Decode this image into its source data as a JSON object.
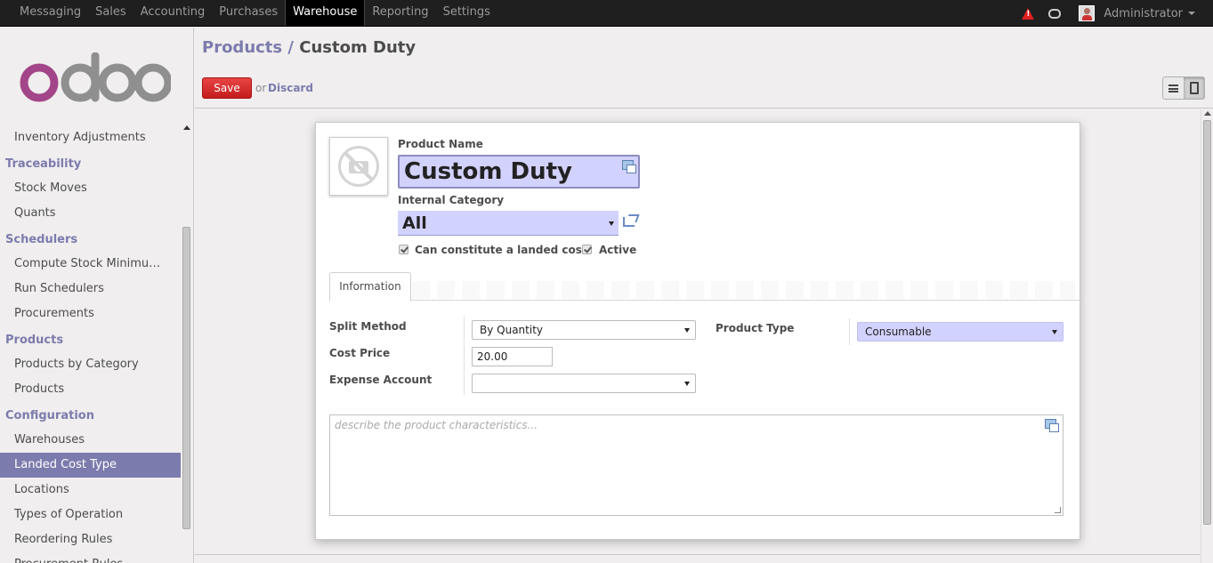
{
  "topbar": {
    "menu": [
      "Messaging",
      "Sales",
      "Accounting",
      "Purchases",
      "Warehouse",
      "Reporting",
      "Settings"
    ],
    "active": "Warehouse",
    "user": "Administrator"
  },
  "sidebar": {
    "items": [
      {
        "type": "item",
        "label": "Inventory Adjustments"
      },
      {
        "type": "section",
        "label": "Traceability"
      },
      {
        "type": "item",
        "label": "Stock Moves"
      },
      {
        "type": "item",
        "label": "Quants"
      },
      {
        "type": "section",
        "label": "Schedulers"
      },
      {
        "type": "item",
        "label": "Compute Stock Minimu…"
      },
      {
        "type": "item",
        "label": "Run Schedulers"
      },
      {
        "type": "item",
        "label": "Procurements"
      },
      {
        "type": "section",
        "label": "Products"
      },
      {
        "type": "item",
        "label": "Products by Category"
      },
      {
        "type": "item",
        "label": "Products"
      },
      {
        "type": "section",
        "label": "Configuration"
      },
      {
        "type": "item",
        "label": "Warehouses"
      },
      {
        "type": "item",
        "label": "Landed Cost Type",
        "active": true
      },
      {
        "type": "item",
        "label": "Locations"
      },
      {
        "type": "item",
        "label": "Types of Operation"
      },
      {
        "type": "item",
        "label": "Reordering Rules"
      },
      {
        "type": "item",
        "label": "Procurement Rules"
      }
    ]
  },
  "header": {
    "breadcrumb_parent": "Products",
    "breadcrumb_sep": "/",
    "breadcrumb_current": "Custom Duty",
    "save_label": "Save",
    "or_label": "or",
    "discard_label": "Discard"
  },
  "form": {
    "product_name_label": "Product Name",
    "product_name_value": "Custom Duty",
    "internal_category_label": "Internal Category",
    "internal_category_value": "All",
    "landed_cost_label": "Can constitute a landed cost",
    "active_label": "Active",
    "tab_information": "Information",
    "split_method_label": "Split Method",
    "split_method_value": "By Quantity",
    "cost_price_label": "Cost Price",
    "cost_price_value": "20.00",
    "expense_account_label": "Expense Account",
    "expense_account_value": "",
    "product_type_label": "Product Type",
    "product_type_value": "Consumable",
    "description_placeholder": "describe the product characteristics..."
  },
  "colors": {
    "accent": "#7c7bad",
    "save": "#dc3030",
    "highlight_input": "#d2d2ff",
    "logo_o": "#a24689",
    "logo_doo": "#8f8f8f"
  },
  "icons": {
    "warning": "warning-icon",
    "chat": "chat-icon",
    "avatar": "avatar",
    "translate": "translate-icon",
    "external": "external-link-icon",
    "camera": "no-image-icon"
  }
}
